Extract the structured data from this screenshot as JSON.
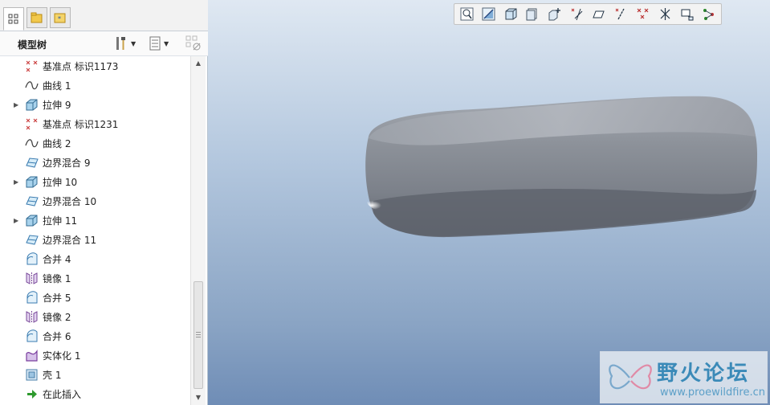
{
  "left_panel": {
    "tabs": [
      {
        "name": "model-tree-tab",
        "icon": "tree-icon"
      },
      {
        "name": "folder-browser-tab",
        "icon": "folder-icon"
      },
      {
        "name": "favorites-tab",
        "icon": "favorites-folder-icon"
      }
    ],
    "tree_title": "模型树",
    "tree_items": [
      {
        "label": "基准点 标识1173",
        "icon": "datum-point-icon",
        "expandable": false
      },
      {
        "label": "曲线 1",
        "icon": "curve-icon",
        "expandable": false
      },
      {
        "label": "拉伸 9",
        "icon": "extrude-icon",
        "expandable": true
      },
      {
        "label": "基准点 标识1231",
        "icon": "datum-point-icon",
        "expandable": false
      },
      {
        "label": "曲线 2",
        "icon": "curve-icon",
        "expandable": false
      },
      {
        "label": "边界混合 9",
        "icon": "boundary-blend-icon",
        "expandable": false
      },
      {
        "label": "拉伸 10",
        "icon": "extrude-icon",
        "expandable": true
      },
      {
        "label": "边界混合 10",
        "icon": "boundary-blend-icon",
        "expandable": false
      },
      {
        "label": "拉伸 11",
        "icon": "extrude-icon",
        "expandable": true
      },
      {
        "label": "边界混合 11",
        "icon": "boundary-blend-icon",
        "expandable": false
      },
      {
        "label": "合并 4",
        "icon": "merge-icon",
        "expandable": false
      },
      {
        "label": "镜像 1",
        "icon": "mirror-icon",
        "expandable": false
      },
      {
        "label": "合并 5",
        "icon": "merge-icon",
        "expandable": false
      },
      {
        "label": "镜像 2",
        "icon": "mirror-icon",
        "expandable": false
      },
      {
        "label": "合并 6",
        "icon": "merge-icon",
        "expandable": false
      },
      {
        "label": "实体化 1",
        "icon": "solidify-icon",
        "expandable": false
      },
      {
        "label": "壳 1",
        "icon": "shell-icon",
        "expandable": false
      },
      {
        "label": "在此插入",
        "icon": "insert-here-arrow-icon",
        "expandable": false
      }
    ]
  },
  "viewport": {
    "toolbar_icons": [
      "zoom-fit-icon",
      "repaint-icon",
      "display-style-icon",
      "saved-views-icon",
      "view-manager-icon",
      "datum-display-filter-icon",
      "datum-plane-icon",
      "datum-axis-icon",
      "datum-point-display-icon",
      "csys-display-icon",
      "spin-center-icon",
      "annotation-display-icon"
    ],
    "watermark": {
      "text": "野火论坛",
      "url": "www.proewildfire.cn"
    }
  },
  "colors": {
    "viewport_top": "#dfe8f2",
    "viewport_bottom": "#6f8db6",
    "model_gray": "#8a9098",
    "watermark_blue": "#3b8ab8"
  }
}
